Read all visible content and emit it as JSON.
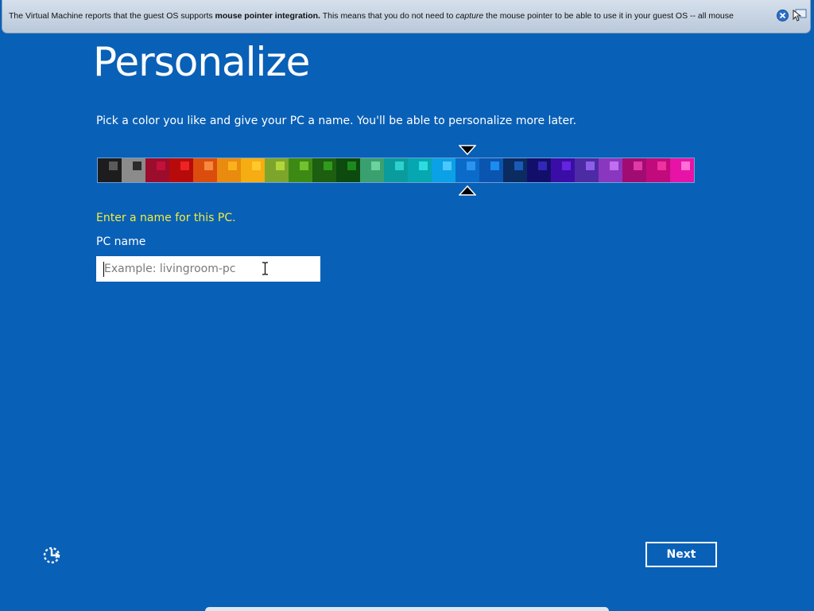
{
  "vm_notice": {
    "text_before": "The Virtual Machine reports that the guest OS supports ",
    "text_bold": "mouse pointer integration.",
    "text_middle": " This means that you do not need to ",
    "text_italic": "capture",
    "text_after": " the mouse pointer to be able to use it in your guest OS -- all mouse",
    "close_icon": "close-circle-icon",
    "mute_icon": "mouse-pointer-integration-icon"
  },
  "page": {
    "title": "Personalize",
    "instruction": "Pick a color you like and give your PC a name. You'll be able to personalize more later.",
    "name_prompt": "Enter a name for this PC.",
    "field_label": "PC name",
    "input_placeholder": "Example: livingroom-pc",
    "input_value": "",
    "next_label": "Next",
    "ease_icon": "ease-of-access-icon"
  },
  "colors": {
    "background": "#0960b7",
    "prompt_yellow": "#f2ee3a",
    "selected_index": 15,
    "swatches": [
      {
        "bg": "#1d1d1d",
        "accent": "#5a5a5a"
      },
      {
        "bg": "#8b8b8b",
        "accent": "#2b2b2b"
      },
      {
        "bg": "#9c0c2c",
        "accent": "#c4113a"
      },
      {
        "bg": "#b70b0b",
        "accent": "#ef2323"
      },
      {
        "bg": "#db4d0d",
        "accent": "#f58a3f"
      },
      {
        "bg": "#e88b0e",
        "accent": "#f9b21e"
      },
      {
        "bg": "#f5ad11",
        "accent": "#ffc92e"
      },
      {
        "bg": "#7ea52b",
        "accent": "#b1d63b"
      },
      {
        "bg": "#3c8a14",
        "accent": "#74c12e"
      },
      {
        "bg": "#1d5e10",
        "accent": "#2f9a1c"
      },
      {
        "bg": "#0d4a0d",
        "accent": "#1d8a1d"
      },
      {
        "bg": "#3aa06f",
        "accent": "#6ad3a0"
      },
      {
        "bg": "#0a9c9c",
        "accent": "#2ed0d0"
      },
      {
        "bg": "#06a7b0",
        "accent": "#2ddce3"
      },
      {
        "bg": "#0aa1e6",
        "accent": "#4cc8ff"
      },
      {
        "bg": "#0b6bc8",
        "accent": "#2c93f0"
      },
      {
        "bg": "#0a55b0",
        "accent": "#1a8cf2"
      },
      {
        "bg": "#0a2c61",
        "accent": "#1a5ab8"
      },
      {
        "bg": "#120f6b",
        "accent": "#3128b6"
      },
      {
        "bg": "#3a0ea6",
        "accent": "#6524e0"
      },
      {
        "bg": "#4d2ba4",
        "accent": "#8d5ee8"
      },
      {
        "bg": "#8a37c0",
        "accent": "#c06ff0"
      },
      {
        "bg": "#a10c72",
        "accent": "#e03aa5"
      },
      {
        "bg": "#c10a7c",
        "accent": "#f0329e"
      },
      {
        "bg": "#e613a6",
        "accent": "#ff6fd6"
      }
    ]
  }
}
